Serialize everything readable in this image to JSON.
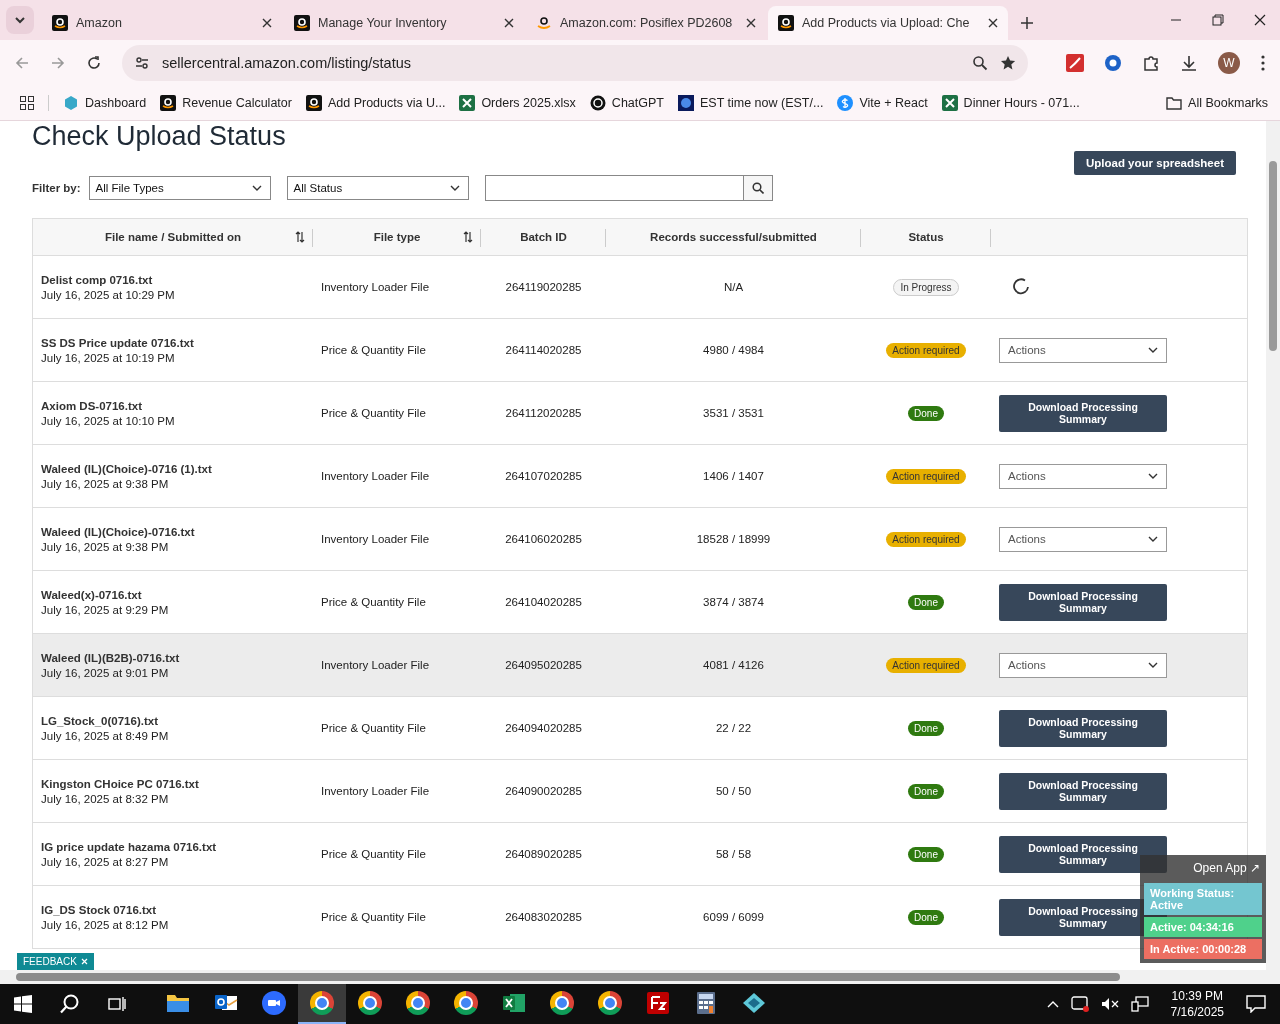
{
  "browser": {
    "tabs": [
      {
        "title": "Amazon",
        "selected": false
      },
      {
        "title": "Manage Your Inventory",
        "selected": false
      },
      {
        "title": "Amazon.com: Posiflex PD2608",
        "selected": false
      },
      {
        "title": "Add Products via Upload: Che",
        "selected": true
      }
    ],
    "address": "sellercentral.amazon.com/listing/status",
    "profile_initial": "W",
    "bookmarks": [
      {
        "label": "Dashboard"
      },
      {
        "label": "Revenue Calculator"
      },
      {
        "label": "Add Products via U..."
      },
      {
        "label": "Orders 2025.xlsx"
      },
      {
        "label": "ChatGPT"
      },
      {
        "label": "EST time now (EST/..."
      },
      {
        "label": "Vite + React"
      },
      {
        "label": "Dinner Hours - 071..."
      }
    ],
    "all_bookmarks": "All Bookmarks"
  },
  "page": {
    "title": "Check Upload Status",
    "upload_button": "Upload your spreadsheet",
    "filter_label": "Filter by:",
    "filters": [
      {
        "value": "All File Types"
      },
      {
        "value": "All Status"
      }
    ],
    "columns": [
      {
        "label": "File name / Submitted on",
        "sortable": true
      },
      {
        "label": "File type",
        "sortable": true
      },
      {
        "label": "Batch ID",
        "sortable": false
      },
      {
        "label": "Records successful/submitted",
        "sortable": false
      },
      {
        "label": "Status",
        "sortable": false
      }
    ],
    "rows": [
      {
        "file_name": "Delist comp 0716.txt",
        "submitted": "July 16, 2025 at 10:29 PM",
        "file_type": "Inventory Loader File",
        "batch_id": "264119020285",
        "records": "N/A",
        "status": {
          "label": "In Progress",
          "kind": "progress"
        },
        "action": {
          "kind": "spinner"
        },
        "highlighted": false
      },
      {
        "file_name": "SS DS Price update 0716.txt",
        "submitted": "July 16, 2025 at 10:19 PM",
        "file_type": "Price & Quantity File",
        "batch_id": "264114020285",
        "records": "4980 / 4984",
        "status": {
          "label": "Action required",
          "kind": "action"
        },
        "action": {
          "kind": "dropdown",
          "label": "Actions"
        },
        "highlighted": false
      },
      {
        "file_name": "Axiom DS-0716.txt",
        "submitted": "July 16, 2025 at 10:10 PM",
        "file_type": "Price & Quantity File",
        "batch_id": "264112020285",
        "records": "3531 / 3531",
        "status": {
          "label": "Done",
          "kind": "done"
        },
        "action": {
          "kind": "button",
          "label": "Download Processing Summary"
        },
        "highlighted": false
      },
      {
        "file_name": "Waleed (IL)(Choice)-0716 (1).txt",
        "submitted": "July 16, 2025 at 9:38 PM",
        "file_type": "Inventory Loader File",
        "batch_id": "264107020285",
        "records": "1406 / 1407",
        "status": {
          "label": "Action required",
          "kind": "action"
        },
        "action": {
          "kind": "dropdown",
          "label": "Actions"
        },
        "highlighted": false
      },
      {
        "file_name": "Waleed (IL)(Choice)-0716.txt",
        "submitted": "July 16, 2025 at 9:38 PM",
        "file_type": "Inventory Loader File",
        "batch_id": "264106020285",
        "records": "18528 / 18999",
        "status": {
          "label": "Action required",
          "kind": "action"
        },
        "action": {
          "kind": "dropdown",
          "label": "Actions"
        },
        "highlighted": false
      },
      {
        "file_name": "Waleed(x)-0716.txt",
        "submitted": "July 16, 2025 at 9:29 PM",
        "file_type": "Price & Quantity File",
        "batch_id": "264104020285",
        "records": "3874 / 3874",
        "status": {
          "label": "Done",
          "kind": "done"
        },
        "action": {
          "kind": "button",
          "label": "Download Processing Summary"
        },
        "highlighted": false
      },
      {
        "file_name": "Waleed (IL)(B2B)-0716.txt",
        "submitted": "July 16, 2025 at 9:01 PM",
        "file_type": "Inventory Loader File",
        "batch_id": "264095020285",
        "records": "4081 / 4126",
        "status": {
          "label": "Action required",
          "kind": "action"
        },
        "action": {
          "kind": "dropdown",
          "label": "Actions"
        },
        "highlighted": true
      },
      {
        "file_name": "LG_Stock_0(0716).txt",
        "submitted": "July 16, 2025 at 8:49 PM",
        "file_type": "Price & Quantity File",
        "batch_id": "264094020285",
        "records": "22 / 22",
        "status": {
          "label": "Done",
          "kind": "done"
        },
        "action": {
          "kind": "button",
          "label": "Download Processing Summary"
        },
        "highlighted": false
      },
      {
        "file_name": "Kingston CHoice PC 0716.txt",
        "submitted": "July 16, 2025 at 8:32 PM",
        "file_type": "Inventory Loader File",
        "batch_id": "264090020285",
        "records": "50 / 50",
        "status": {
          "label": "Done",
          "kind": "done"
        },
        "action": {
          "kind": "button",
          "label": "Download Processing Summary"
        },
        "highlighted": false
      },
      {
        "file_name": "IG price update hazama 0716.txt",
        "submitted": "July 16, 2025 at 8:27 PM",
        "file_type": "Price & Quantity File",
        "batch_id": "264089020285",
        "records": "58 / 58",
        "status": {
          "label": "Done",
          "kind": "done"
        },
        "action": {
          "kind": "button",
          "label": "Download Processing Summary"
        },
        "highlighted": false
      },
      {
        "file_name": "IG_DS Stock 0716.txt",
        "submitted": "July 16, 2025 at 8:12 PM",
        "file_type": "Price & Quantity File",
        "batch_id": "264083020285",
        "records": "6099 / 6099",
        "status": {
          "label": "Done",
          "kind": "done"
        },
        "action": {
          "kind": "button",
          "label": "Download Processing Summary"
        },
        "highlighted": false
      }
    ],
    "feedback": "FEEDBACK"
  },
  "tracker": {
    "open_app": "Open App ↗",
    "lines": [
      {
        "text": "Working Status: Active",
        "color": "#74c6d0"
      },
      {
        "text": "Active: 04:34:16",
        "color": "#4fd18b"
      },
      {
        "text": "In Active: 00:00:28",
        "color": "#ec6f62"
      }
    ]
  },
  "taskbar": {
    "apps": [
      {
        "kind": "folder",
        "selected": false
      },
      {
        "kind": "outlook",
        "selected": false
      },
      {
        "kind": "zoom",
        "selected": false
      },
      {
        "kind": "chrome",
        "selected": true
      },
      {
        "kind": "chrome",
        "selected": false
      },
      {
        "kind": "chrome",
        "selected": false
      },
      {
        "kind": "chrome",
        "selected": false
      },
      {
        "kind": "excel",
        "selected": false
      },
      {
        "kind": "chrome",
        "selected": false
      },
      {
        "kind": "chrome",
        "selected": false
      },
      {
        "kind": "filezilla",
        "selected": false
      },
      {
        "kind": "calculator",
        "selected": false
      },
      {
        "kind": "diamond",
        "selected": false
      }
    ],
    "time": "10:39 PM",
    "date": "7/16/2025"
  }
}
